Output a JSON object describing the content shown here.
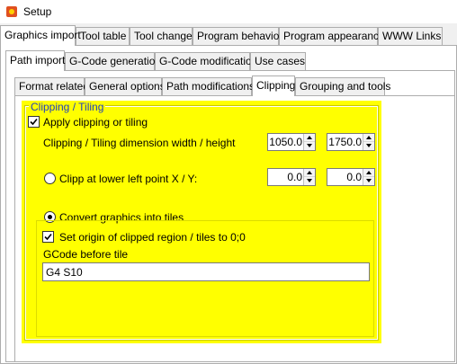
{
  "window": {
    "title": "Setup"
  },
  "main_tabs": [
    "Graphics import",
    "Tool table",
    "Tool change",
    "Program behavior",
    "Program appearance",
    "WWW Links"
  ],
  "sub_tabs": [
    "Path import",
    "G-Code generation",
    "G-Code modification",
    "Use cases"
  ],
  "inner_tabs": [
    "Format related",
    "General options",
    "Path modifications",
    "Clipping",
    "Grouping and tools"
  ],
  "group": {
    "title": "Clipping / Tiling",
    "apply_label": "Apply clipping or tiling",
    "apply_checked": true,
    "dimension_label": "Clipping / Tiling dimension width / height",
    "width_value": "1050.0",
    "height_value": "1750.0",
    "clip_label": "Clipp at lower left point X / Y:",
    "clip_selected": false,
    "x_value": "0.0",
    "y_value": "0.0",
    "tiles_label": "Convert graphics into tiles",
    "tiles_selected": true,
    "origin_label": "Set origin of clipped region / tiles to 0;0",
    "origin_checked": true,
    "gcode_label": "GCode before tile",
    "gcode_value": "G4 S10"
  },
  "colors": {
    "group_background": "#ffff00",
    "group_title": "#1f3fbf"
  }
}
